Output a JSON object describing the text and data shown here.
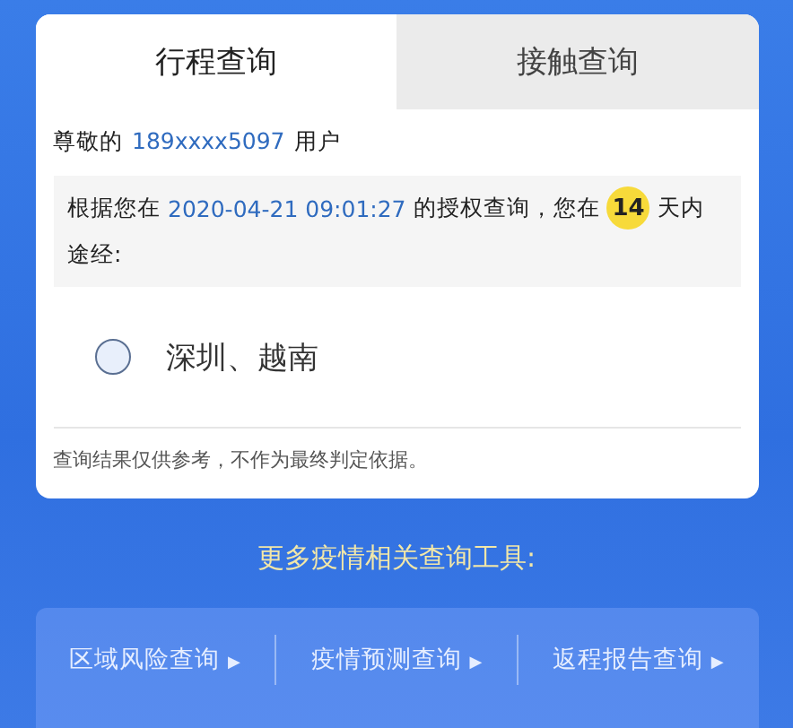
{
  "tabs": [
    {
      "label": "行程查询",
      "selected": true
    },
    {
      "label": "接触查询",
      "selected": false
    }
  ],
  "greeting": {
    "prefix": "尊敬的",
    "phone": "189xxxx5097",
    "suffix": "用户"
  },
  "notice": {
    "before": "根据您在",
    "datetime": "2020-04-21 09:01:27",
    "middle": "的授权查询，您在",
    "days": "14",
    "after": "天内",
    "line2": "途经:"
  },
  "places": [
    {
      "text": "深圳、越南",
      "selected": false
    }
  ],
  "disclaimer": "查询结果仅供参考，不作为最终判定依据。",
  "more_title": "更多疫情相关查询工具:",
  "tools": [
    {
      "label": "区域风险查询",
      "arrow": "▶"
    },
    {
      "label": "疫情预测查询",
      "arrow": "▶"
    },
    {
      "label": "返程报告查询",
      "arrow": "▶"
    }
  ]
}
